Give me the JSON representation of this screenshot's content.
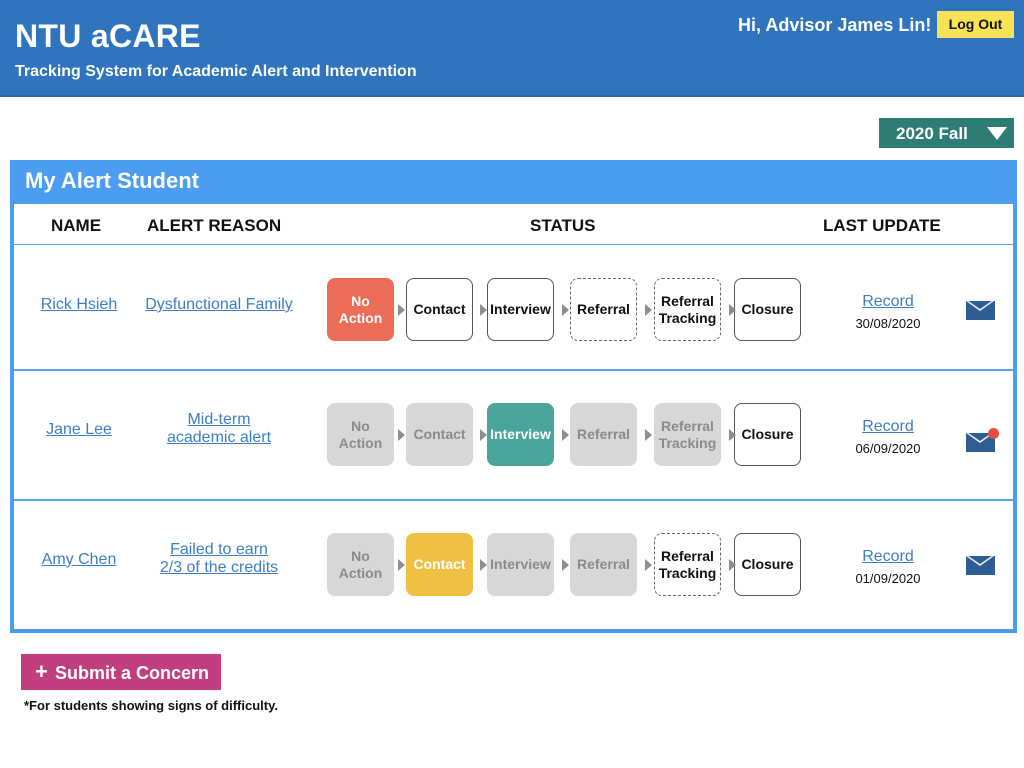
{
  "header": {
    "title": "NTU aCARE",
    "subtitle": "Tracking System for Academic Alert and Intervention",
    "greeting": "Hi, Advisor James Lin!",
    "logout_label": "Log Out"
  },
  "semester": {
    "selected": "2020 Fall"
  },
  "panel": {
    "title": "My Alert Student",
    "columns": {
      "name": "NAME",
      "reason": "ALERT REASON",
      "status": "STATUS",
      "last_update": "LAST UPDATE"
    }
  },
  "steps": [
    "No Action",
    "Contact",
    "Interview",
    "Referral",
    "Referral Tracking",
    "Closure"
  ],
  "rows": [
    {
      "name": "Rick Hsieh",
      "reason": [
        "Dysfunctional Family"
      ],
      "step_states": [
        "red",
        "solid",
        "solid",
        "dashed",
        "dashed",
        "solid"
      ],
      "record_label": "Record",
      "date": "30/08/2020",
      "unread": false
    },
    {
      "name": "Jane Lee",
      "reason": [
        "Mid-term",
        "academic alert"
      ],
      "step_states": [
        "gray",
        "gray",
        "teal",
        "gray",
        "gray",
        "solid"
      ],
      "record_label": "Record",
      "date": "06/09/2020",
      "unread": true
    },
    {
      "name": "Amy Chen",
      "reason": [
        "Failed to earn",
        "2/3 of the credits"
      ],
      "step_states": [
        "gray",
        "yellow",
        "gray",
        "gray",
        "dashed",
        "solid"
      ],
      "record_label": "Record",
      "date": "01/09/2020",
      "unread": false
    }
  ],
  "submit": {
    "plus": "+",
    "label": "Submit a Concern"
  },
  "footnote": "*For students showing signs of difficulty.",
  "colors": {
    "header_bg": "#2f74bd",
    "panel_bg": "#4a9df0",
    "logout_bg": "#f8e255",
    "semester_bg": "#2e7d74",
    "no_action_active": "#ec6d57",
    "interview_active": "#4aa59b",
    "contact_active": "#f0c044",
    "submit_bg": "#c23f7f",
    "link": "#3d7ec4",
    "mail_icon": "#2d5d93",
    "unread_dot": "#e74c3c"
  }
}
